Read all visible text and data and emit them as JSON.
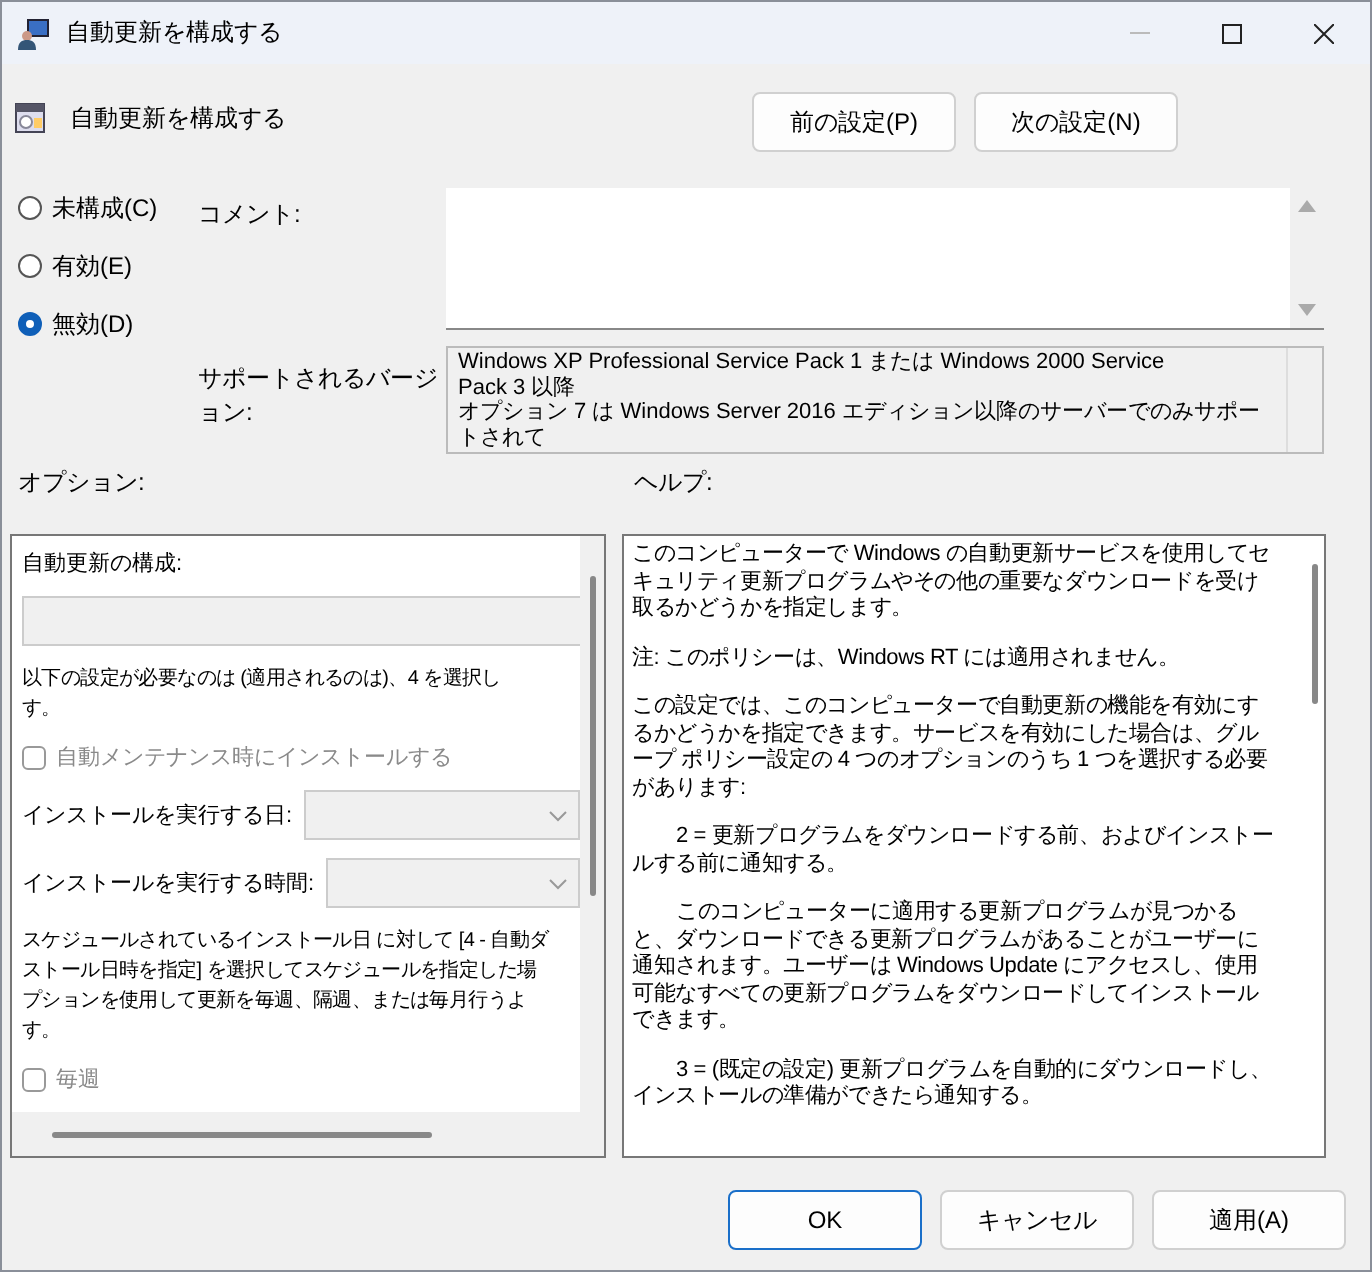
{
  "window": {
    "title": "自動更新を構成する"
  },
  "policy": {
    "title": "自動更新を構成する"
  },
  "nav_buttons": [
    {
      "label": "前の設定(P)"
    },
    {
      "label": "次の設定(N)"
    }
  ],
  "state_options": [
    {
      "label": "未構成(C)",
      "selected": false
    },
    {
      "label": "有効(E)",
      "selected": false
    },
    {
      "label": "無効(D)",
      "selected": true
    }
  ],
  "comment": {
    "label": "コメント:"
  },
  "supported": {
    "label": "サポートされるバージョン:",
    "lines": [
      "Windows XP Professional Service Pack 1 または Windows 2000 Service",
      "Pack 3 以降",
      "オプション 7 は Windows Server 2016 エディション以降のサーバーでのみサポートされて"
    ]
  },
  "options": {
    "label": "オプション:",
    "items": [
      {
        "kind": "heading",
        "text": "自動更新の構成:"
      },
      {
        "kind": "select",
        "disabled": true
      },
      {
        "kind": "paragraph",
        "lines": [
          "以下の設定が必要なのは (適用されるのは)、4 を選択し",
          "す。"
        ]
      },
      {
        "kind": "checkbox",
        "text": "自動メンテナンス時にインストールする",
        "checked": false,
        "disabled": true
      },
      {
        "kind": "combo",
        "text": "インストールを実行する日:",
        "disabled": true
      },
      {
        "kind": "combo",
        "text": "インストールを実行する時間:",
        "disabled": true
      },
      {
        "kind": "paragraph",
        "lines": [
          "スケジュールされているインストール日 に対して [4 - 自動ダ",
          "ストール日時を指定] を選択してスケジュールを指定した場",
          "プションを使用して更新を毎週、隔週、または毎月行うよ",
          "す。"
        ]
      },
      {
        "kind": "checkbox",
        "text": "毎週",
        "checked": false,
        "disabled": true
      }
    ]
  },
  "help": {
    "label": "ヘルプ:",
    "paragraphs": [
      {
        "kind": "plain",
        "text": "このコンピューターで Windows の自動更新サービスを使用してセキュリティ更新プログラムやその他の重要なダウンロードを受け取るかどうかを指定します。"
      },
      {
        "kind": "plain",
        "text": "注: このポリシーは、Windows RT には適用されません。"
      },
      {
        "kind": "plain",
        "text": "この設定では、このコンピューターで自動更新の機能を有効にするかどうかを指定できます。サービスを有効にした場合は、グループ ポリシー設定の 4 つのオプションのうち 1 つを選択する必要があります:"
      },
      {
        "kind": "indented",
        "text": "2 = 更新プログラムをダウンロードする前、およびインストールする前に通知する。"
      },
      {
        "kind": "indented",
        "text": "このコンピューターに適用する更新プログラムが見つかると、ダウンロードできる更新プログラムがあることがユーザーに通知されます。ユーザーは Windows Update にアクセスし、使用可能なすべての更新プログラムをダウンロードしてインストールできます。"
      },
      {
        "kind": "indented",
        "text": "3 = (既定の設定) 更新プログラムを自動的にダウンロードし、インストールの準備ができたら通知する。"
      }
    ]
  },
  "footer_buttons": [
    {
      "label": "OK",
      "default": true
    },
    {
      "label": "キャンセル",
      "default": false
    },
    {
      "label": "適用(A)",
      "default": false
    }
  ]
}
